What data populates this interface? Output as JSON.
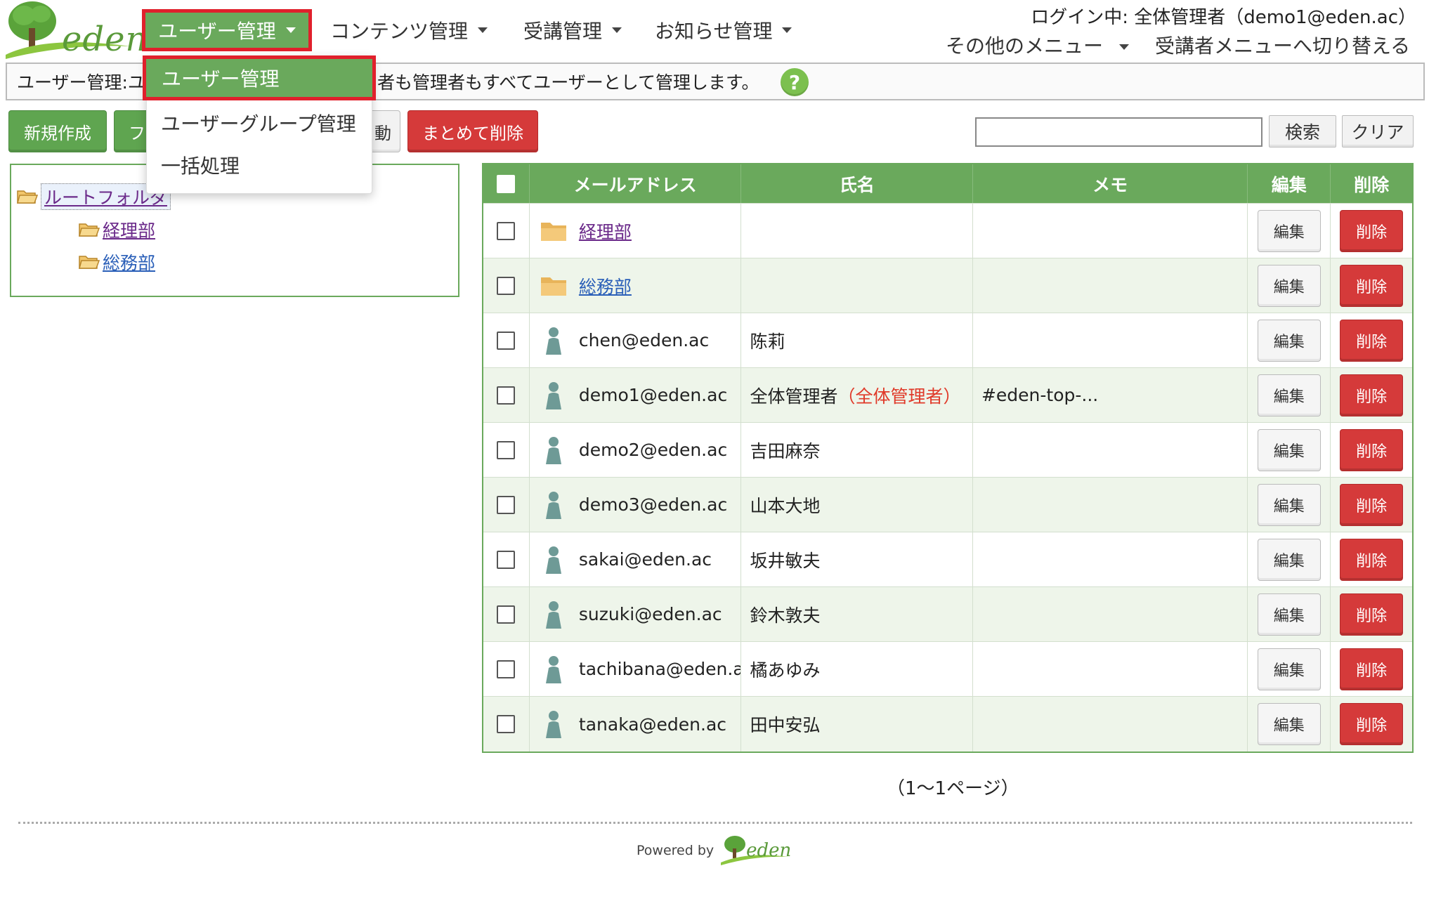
{
  "brand": {
    "logo_text": "eden"
  },
  "nav": {
    "user_mgmt": "ユーザー管理",
    "content_mgmt": "コンテンツ管理",
    "course_mgmt": "受講管理",
    "notice_mgmt": "お知らせ管理",
    "other_menu": "その他のメニュー",
    "switch_learner": "受講者メニューへ切り替える"
  },
  "login_info": "ログイン中: 全体管理者（demo1@eden.ac）",
  "dropdown": {
    "items": [
      {
        "label": "ユーザー管理"
      },
      {
        "label": "ユーザーグループ管理"
      },
      {
        "label": "一括処理"
      }
    ]
  },
  "infobar": {
    "prefix": "ユーザー管理:ユ",
    "suffix": "者も管理者もすべてユーザーとして管理します。",
    "help": "?"
  },
  "toolbar": {
    "new": "新規作成",
    "folder": "フ",
    "move": "動",
    "bulk_delete": "まとめて削除",
    "search_value": "",
    "search": "検索",
    "clear": "クリア"
  },
  "tree": {
    "root": "ルートフォルダ",
    "children": [
      "経理部",
      "総務部"
    ]
  },
  "table": {
    "headers": {
      "mail": "メールアドレス",
      "name": "氏名",
      "memo": "メモ",
      "edit": "編集",
      "delete": "削除"
    },
    "edit_label": "編集",
    "delete_label": "削除",
    "rows": [
      {
        "type": "folder",
        "mail": "経理部",
        "name": "",
        "role": "",
        "memo": ""
      },
      {
        "type": "folder",
        "mail": "総務部",
        "name": "",
        "role": "",
        "memo": ""
      },
      {
        "type": "user",
        "mail": "chen@eden.ac",
        "name": "陈莉",
        "role": "",
        "memo": ""
      },
      {
        "type": "user",
        "mail": "demo1@eden.ac",
        "name": "全体管理者",
        "role": "（全体管理者）",
        "memo": "#eden-top-..."
      },
      {
        "type": "user",
        "mail": "demo2@eden.ac",
        "name": "吉田麻奈",
        "role": "",
        "memo": ""
      },
      {
        "type": "user",
        "mail": "demo3@eden.ac",
        "name": "山本大地",
        "role": "",
        "memo": ""
      },
      {
        "type": "user",
        "mail": "sakai@eden.ac",
        "name": "坂井敏夫",
        "role": "",
        "memo": ""
      },
      {
        "type": "user",
        "mail": "suzuki@eden.ac",
        "name": "鈴木敦夫",
        "role": "",
        "memo": ""
      },
      {
        "type": "user",
        "mail": "tachibana@eden.ac",
        "name": "橘あゆみ",
        "role": "",
        "memo": ""
      },
      {
        "type": "user",
        "mail": "tanaka@eden.ac",
        "name": "田中安弘",
        "role": "",
        "memo": ""
      }
    ]
  },
  "pager": "（1～1ページ）",
  "footer": {
    "powered_by": "Powered by",
    "logo_text": "eden"
  },
  "colors": {
    "brand_green": "#6aa95c",
    "highlight_red": "#e0202c",
    "delete_red": "#d53a3a",
    "link_purple": "#6b2a8a",
    "link_blue": "#2a5fb8",
    "row_alt": "#eef5ea",
    "help_green": "#7cc04f"
  }
}
